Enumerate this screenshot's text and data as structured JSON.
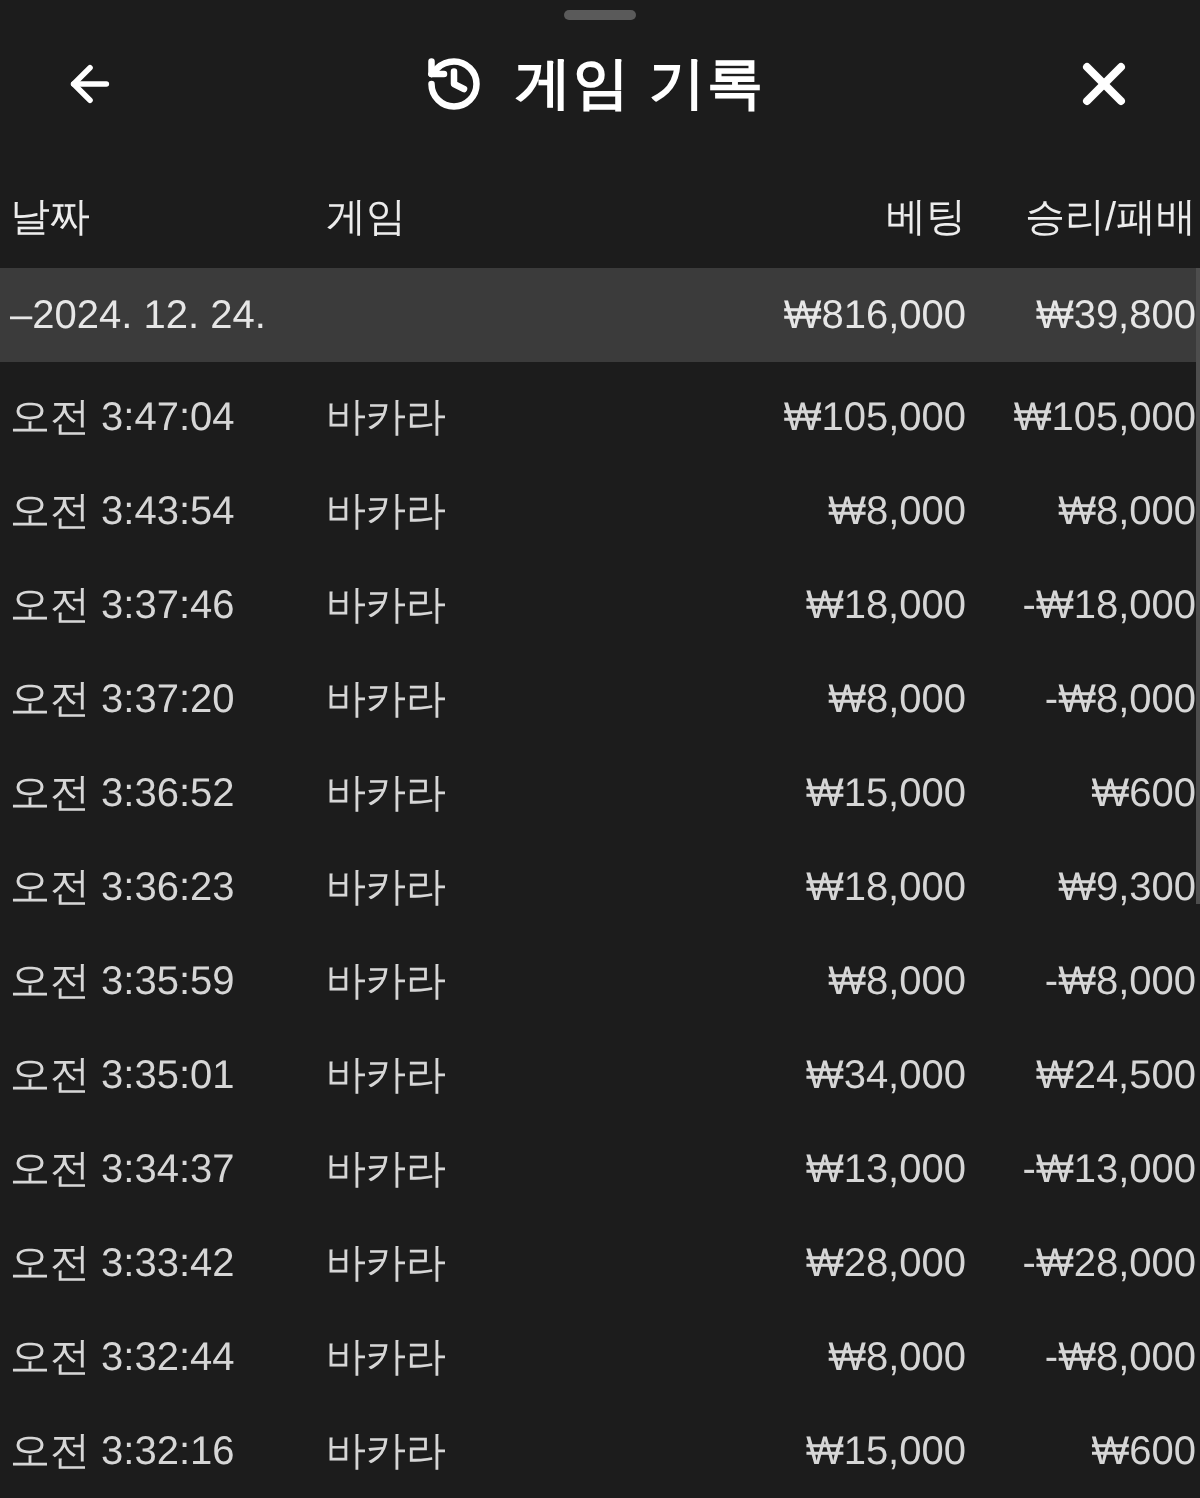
{
  "header": {
    "title": "게임 기록"
  },
  "table": {
    "columns": [
      "날짜",
      "게임",
      "베팅",
      "승리/패배"
    ],
    "group": {
      "date": "–2024. 12. 24.",
      "bet": "₩816,000",
      "result": "₩39,800"
    },
    "rows": [
      {
        "time": "오전 3:47:04",
        "game": "바카라",
        "bet": "₩105,000",
        "result": "₩105,000"
      },
      {
        "time": "오전 3:43:54",
        "game": "바카라",
        "bet": "₩8,000",
        "result": "₩8,000"
      },
      {
        "time": "오전 3:37:46",
        "game": "바카라",
        "bet": "₩18,000",
        "result": "-₩18,000"
      },
      {
        "time": "오전 3:37:20",
        "game": "바카라",
        "bet": "₩8,000",
        "result": "-₩8,000"
      },
      {
        "time": "오전 3:36:52",
        "game": "바카라",
        "bet": "₩15,000",
        "result": "₩600"
      },
      {
        "time": "오전 3:36:23",
        "game": "바카라",
        "bet": "₩18,000",
        "result": "₩9,300"
      },
      {
        "time": "오전 3:35:59",
        "game": "바카라",
        "bet": "₩8,000",
        "result": "-₩8,000"
      },
      {
        "time": "오전 3:35:01",
        "game": "바카라",
        "bet": "₩34,000",
        "result": "₩24,500"
      },
      {
        "time": "오전 3:34:37",
        "game": "바카라",
        "bet": "₩13,000",
        "result": "-₩13,000"
      },
      {
        "time": "오전 3:33:42",
        "game": "바카라",
        "bet": "₩28,000",
        "result": "-₩28,000"
      },
      {
        "time": "오전 3:32:44",
        "game": "바카라",
        "bet": "₩8,000",
        "result": "-₩8,000"
      },
      {
        "time": "오전 3:32:16",
        "game": "바카라",
        "bet": "₩15,000",
        "result": "₩600"
      }
    ]
  }
}
